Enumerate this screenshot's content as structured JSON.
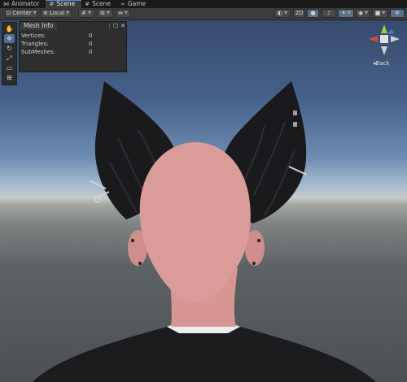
{
  "tabs": [
    {
      "icon": "animator-icon",
      "label": "Animator"
    },
    {
      "icon": "scene-icon",
      "label": "Scene",
      "active": true
    },
    {
      "icon": "scene-icon",
      "label": "Scene"
    },
    {
      "icon": "game-icon",
      "label": "Game"
    }
  ],
  "toolbar": {
    "pivot_label": "Center",
    "space_label": "Local",
    "mode_2d_label": "2D"
  },
  "tools": [
    "hand-tool",
    "move-tool",
    "rotate-tool",
    "scale-tool",
    "rect-tool",
    "transform-tool"
  ],
  "mesh_info": {
    "title": "Mesh Info",
    "rows": [
      {
        "label": "Vertices:",
        "value": "0"
      },
      {
        "label": "Triangles:",
        "value": "0"
      },
      {
        "label": "SubMeshes:",
        "value": "0"
      }
    ]
  },
  "gizmo": {
    "back_label": "◂Back"
  },
  "colors": {
    "accent": "#4f8ad8",
    "skin": "#d99a97",
    "ears": "#1a1a1c"
  }
}
